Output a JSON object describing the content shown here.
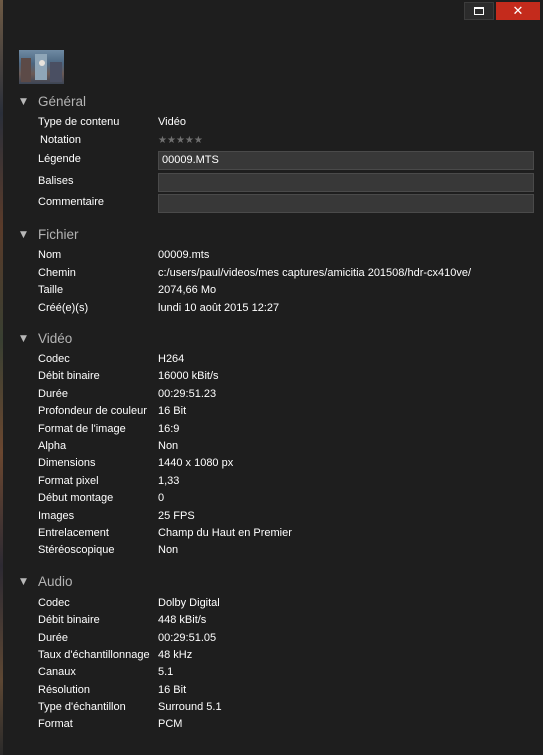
{
  "titlebar": {
    "maximize_icon": "maximize-icon",
    "close_icon": "close-icon",
    "close_glyph": "✕"
  },
  "general": {
    "title": "Général",
    "content_type_label": "Type de contenu",
    "content_type_value": "Vidéo",
    "rating_label": "Notation",
    "rating_value": 0,
    "rating_max": 5,
    "caption_label": "Légende",
    "caption_value": "00009.MTS",
    "tags_label": "Balises",
    "tags_value": "",
    "comment_label": "Commentaire",
    "comment_value": ""
  },
  "file": {
    "title": "Fichier",
    "rows": [
      {
        "label": "Nom",
        "value": "00009.mts"
      },
      {
        "label": "Chemin",
        "value": "c:/users/paul/videos/mes captures/amicitia 201508/hdr-cx410ve/"
      },
      {
        "label": "Taille",
        "value": "2074,66 Mo"
      },
      {
        "label": "Créé(e)(s)",
        "value": "lundi 10 août 2015 12:27"
      }
    ]
  },
  "video": {
    "title": "Vidéo",
    "rows": [
      {
        "label": "Codec",
        "value": "H264"
      },
      {
        "label": "Débit binaire",
        "value": "16000 kBit/s"
      },
      {
        "label": "Durée",
        "value": "00:29:51.23"
      },
      {
        "label": "Profondeur de couleur",
        "value": "16 Bit"
      },
      {
        "label": "Format de l'image",
        "value": "16:9"
      },
      {
        "label": "Alpha",
        "value": "Non"
      },
      {
        "label": "Dimensions",
        "value": "1440 x 1080 px"
      },
      {
        "label": "Format pixel",
        "value": "1,33"
      },
      {
        "label": "Début montage",
        "value": "0"
      },
      {
        "label": "Images",
        "value": "25 FPS"
      },
      {
        "label": "Entrelacement",
        "value": "Champ du Haut en Premier"
      },
      {
        "label": "Stéréoscopique",
        "value": "Non"
      }
    ]
  },
  "audio": {
    "title": "Audio",
    "rows": [
      {
        "label": "Codec",
        "value": "Dolby Digital"
      },
      {
        "label": "Débit binaire",
        "value": "448 kBit/s"
      },
      {
        "label": "Durée",
        "value": "00:29:51.05"
      },
      {
        "label": "Taux d'échantillonnage",
        "value": "48 kHz"
      },
      {
        "label": "Canaux",
        "value": "5.1"
      },
      {
        "label": "Résolution",
        "value": "16 Bit"
      },
      {
        "label": "Type d'échantillon",
        "value": "Surround 5.1"
      },
      {
        "label": "Format",
        "value": "PCM"
      }
    ]
  }
}
